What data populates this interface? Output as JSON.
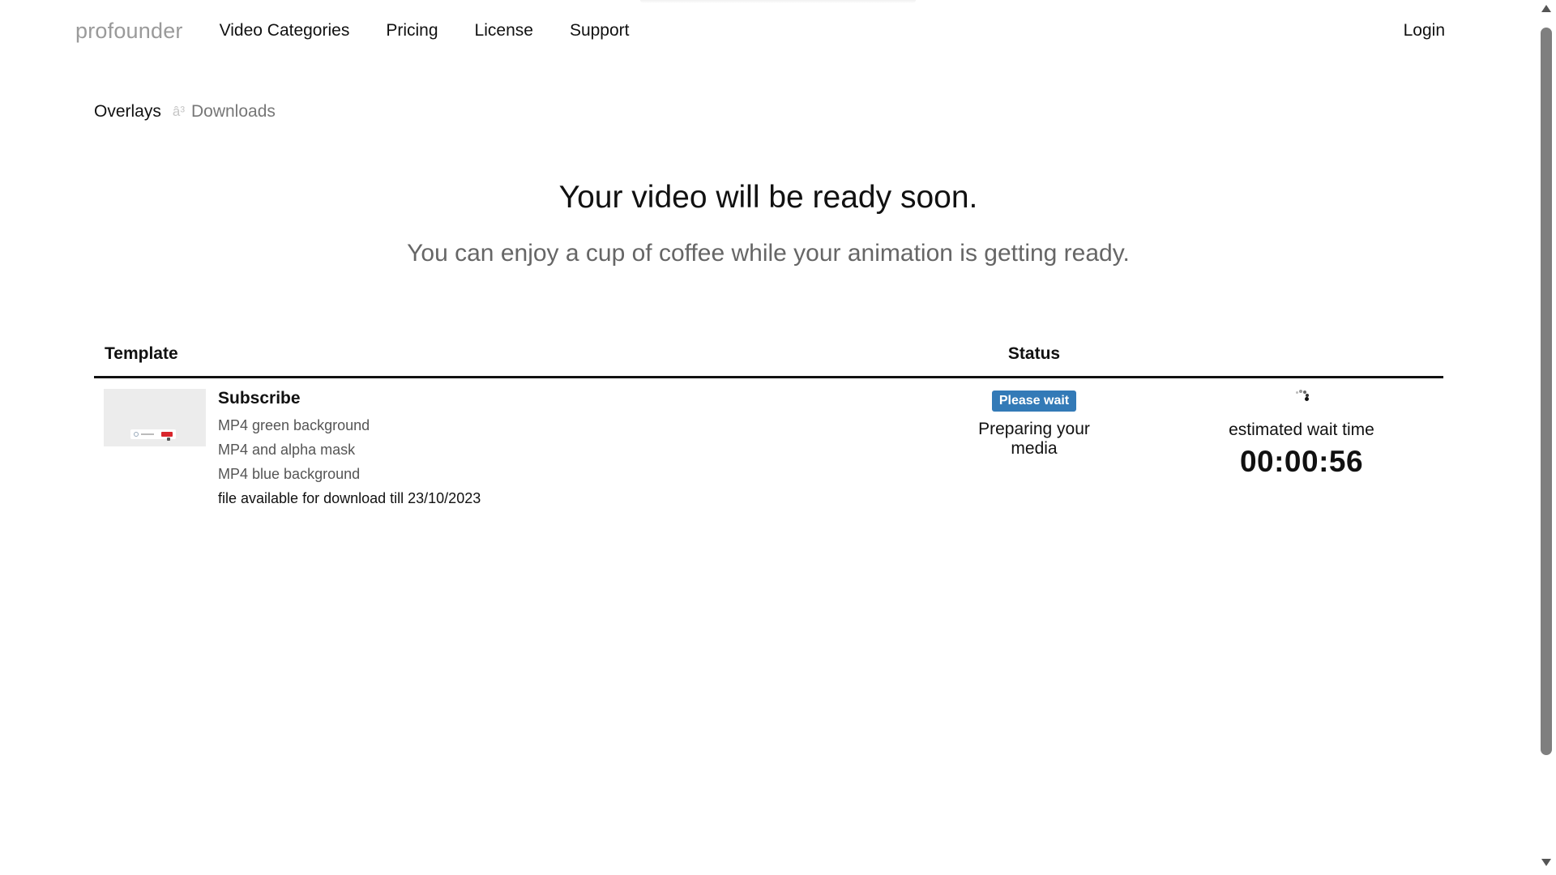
{
  "nav": {
    "brand": "profounder",
    "links": [
      "Video Categories",
      "Pricing",
      "License",
      "Support"
    ],
    "login": "Login"
  },
  "breadcrumb": {
    "parent": "Overlays",
    "separator": "â³",
    "current": "Downloads"
  },
  "hero": {
    "title": "Your video will be ready soon.",
    "subtitle": "You can enjoy a cup of coffee while your animation is getting ready."
  },
  "table": {
    "headers": {
      "template": "Template",
      "status": "Status"
    },
    "rows": [
      {
        "title": "Subscribe",
        "formats": [
          "MP4 green background",
          "MP4 and alpha mask",
          "MP4 blue background"
        ],
        "note": "file available for download till 23/10/2023",
        "badge": "Please wait",
        "status_text": "Preparing your media",
        "wait_label": "estimated wait time",
        "wait_time": "00:00:56"
      }
    ]
  },
  "colors": {
    "badge": "#337ab7",
    "brand": "#9a9a9a"
  },
  "icons": {
    "spinner": "loading-spinner-icon",
    "thumbnail": "template-thumbnail"
  }
}
